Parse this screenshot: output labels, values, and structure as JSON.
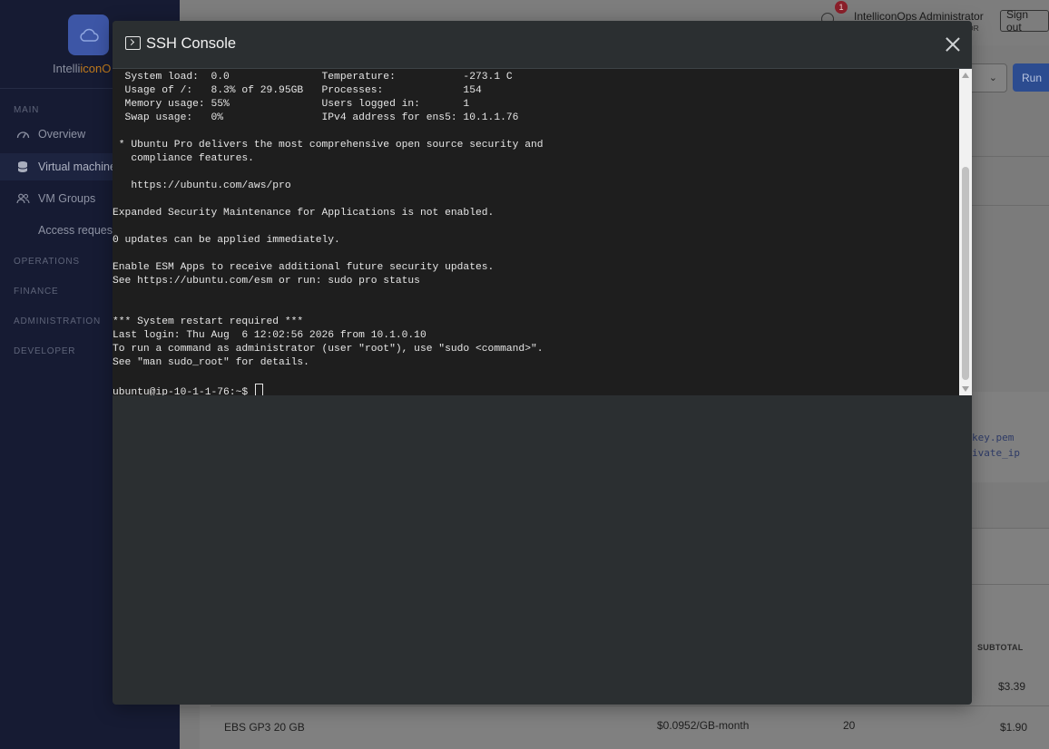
{
  "sidebar": {
    "brand_prefix": "Intelli",
    "brand_accent": "iconO",
    "sections": {
      "main": "MAIN",
      "operations": "OPERATIONS",
      "finance": "FINANCE",
      "administration": "ADMINISTRATION",
      "developer": "DEVELOPER"
    },
    "items": {
      "overview": "Overview",
      "virtual_machines": "Virtual machine",
      "vm_groups": "VM Groups",
      "access_requests": "Access requests"
    }
  },
  "header": {
    "notification_count": "1",
    "user_name": "IntelliconOps Administrator",
    "user_role": "OR",
    "sign_out": "Sign out"
  },
  "toolbar": {
    "run_label": "Run"
  },
  "background": {
    "key_snip_1": "key.pem",
    "key_snip_2": "ivate_ip",
    "subtotal_header": "SUBTOTAL",
    "row1_subtotal": "$3.39",
    "row2": {
      "name": "EBS GP3 20 GB",
      "rate": "$0.0952/GB-month",
      "qty": "20",
      "subtotal": "$1.90"
    }
  },
  "modal": {
    "title": "SSH Console",
    "terminal_lines": [
      "  System load:  0.0               Temperature:           -273.1 C",
      "  Usage of /:   8.3% of 29.95GB   Processes:             154",
      "  Memory usage: 55%               Users logged in:       1",
      "  Swap usage:   0%                IPv4 address for ens5: 10.1.1.76",
      "",
      " * Ubuntu Pro delivers the most comprehensive open source security and",
      "   compliance features.",
      "",
      "   https://ubuntu.com/aws/pro",
      "",
      "Expanded Security Maintenance for Applications is not enabled.",
      "",
      "0 updates can be applied immediately.",
      "",
      "Enable ESM Apps to receive additional future security updates.",
      "See https://ubuntu.com/esm or run: sudo pro status",
      "",
      "",
      "*** System restart required ***",
      "Last login: Thu Aug  6 12:02:56 2026 from 10.1.0.10",
      "To run a command as administrator (user \"root\"), use \"sudo <command>\".",
      "See \"man sudo_root\" for details.",
      ""
    ],
    "prompt": "ubuntu@ip-10-1-1-76:~$ "
  },
  "colors": {
    "sidebar_bg": "#161b33",
    "modal_bg": "#2b2f31",
    "terminal_bg": "#1e1e1e",
    "brand_accent": "#c07a1c",
    "run_button": "#2c4c90",
    "badge": "#8a1f2a"
  }
}
